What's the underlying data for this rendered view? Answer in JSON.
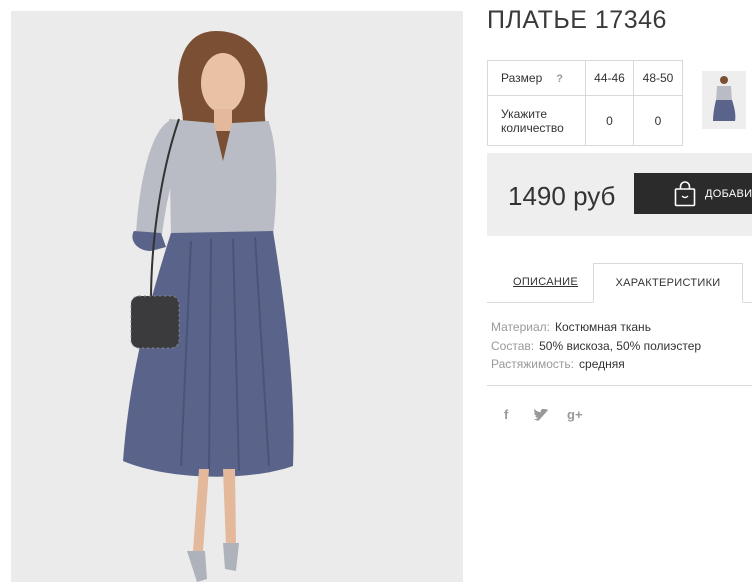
{
  "product": {
    "title": "ПЛАТЬЕ 17346",
    "price": "1490 руб",
    "add_to_cart_label": "ДОБАВИТЬ"
  },
  "size_table": {
    "size_label": "Размер",
    "help": "?",
    "sizes": [
      "44-46",
      "48-50"
    ],
    "qty_label": "Укажите количество",
    "quantities": [
      "0",
      "0"
    ]
  },
  "tabs": {
    "description": "ОПИСАНИЕ",
    "characteristics": "ХАРАКТЕРИСТИКИ"
  },
  "specs": [
    {
      "key": "Материал:",
      "value": "Костюмная ткань"
    },
    {
      "key": "Состав:",
      "value": "50% вискоза, 50% полиэстер"
    },
    {
      "key": "Растяжимость:",
      "value": "средняя"
    }
  ],
  "social": {
    "facebook": "f",
    "twitter": "twitter-icon",
    "googleplus": "g+"
  },
  "colors": {
    "button": "#2b2b2b",
    "price_bg": "#eeeeee",
    "dress_top": "#b9bcc4",
    "dress_skirt": "#5a648a"
  }
}
